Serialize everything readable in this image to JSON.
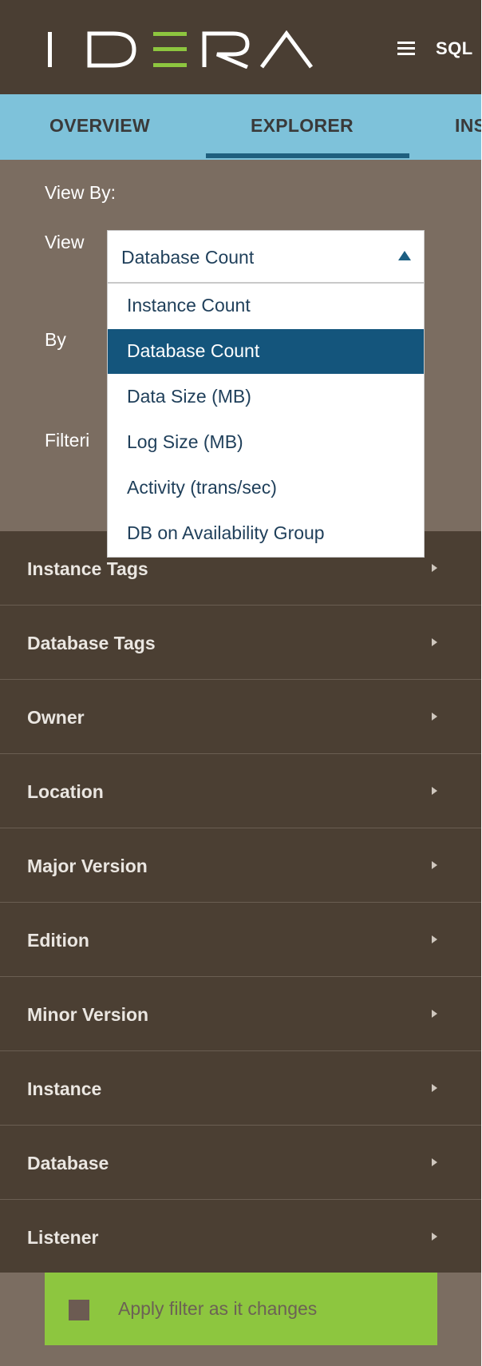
{
  "header": {
    "logo_text": "IDERA",
    "product_label": "SQL",
    "colors": {
      "background": "#4a3e33",
      "logo_accent": "#8dc63f"
    }
  },
  "tabs": [
    {
      "label": "OVERVIEW",
      "active": false
    },
    {
      "label": "EXPLORER",
      "active": true
    },
    {
      "label": "INS",
      "active": false
    }
  ],
  "view_panel": {
    "view_by_label": "View By:",
    "view_label": "View",
    "by_label": "By",
    "filter_label": "Filteri",
    "selected_value": "Database Count",
    "options": [
      {
        "label": "Instance Count",
        "selected": false
      },
      {
        "label": "Database Count",
        "selected": true
      },
      {
        "label": "Data Size (MB)",
        "selected": false
      },
      {
        "label": "Log Size (MB)",
        "selected": false
      },
      {
        "label": "Activity (trans/sec)",
        "selected": false
      },
      {
        "label": "DB on Availability Group",
        "selected": false
      }
    ]
  },
  "filters": [
    {
      "label": "Instance Tags"
    },
    {
      "label": "Database Tags"
    },
    {
      "label": "Owner"
    },
    {
      "label": "Location"
    },
    {
      "label": "Major Version"
    },
    {
      "label": "Edition"
    },
    {
      "label": "Minor Version"
    },
    {
      "label": "Instance"
    },
    {
      "label": "Database"
    },
    {
      "label": "Listener"
    }
  ],
  "footer": {
    "apply_label": "Apply filter as it changes",
    "checked": false
  }
}
